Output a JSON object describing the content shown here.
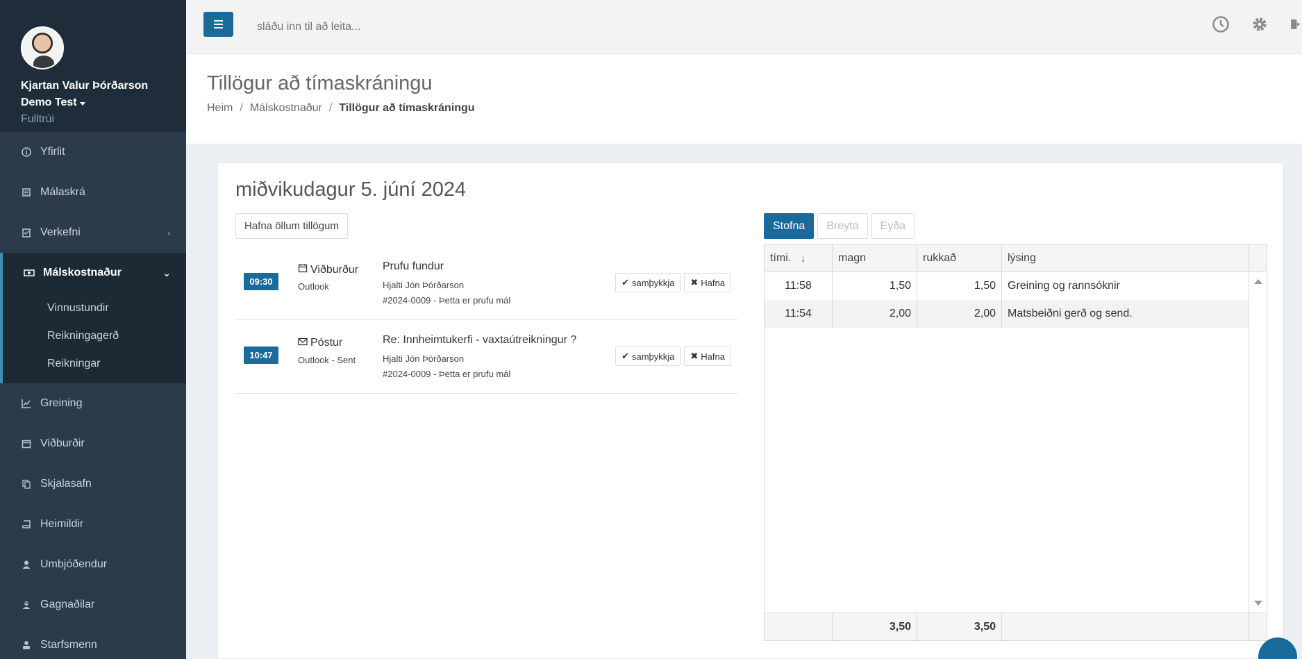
{
  "user": {
    "name": "Kjartan Valur Þórðarson",
    "company": "Demo Test",
    "role": "Fulltrúi"
  },
  "nav": {
    "items": [
      {
        "label": "Yfirlit",
        "icon": "info-circle-icon"
      },
      {
        "label": "Málaskrá",
        "icon": "archive-icon"
      },
      {
        "label": "Verkefni",
        "icon": "checklist-icon"
      },
      {
        "label": "Málskostnaður",
        "icon": "money-icon"
      },
      {
        "label": "Greining",
        "icon": "line-chart-icon"
      },
      {
        "label": "Viðburðir",
        "icon": "calendar-icon"
      },
      {
        "label": "Skjalasafn",
        "icon": "documents-icon"
      },
      {
        "label": "Heimildir",
        "icon": "book-icon"
      },
      {
        "label": "Umbjóðendur",
        "icon": "user-icon"
      },
      {
        "label": "Gagnaðilar",
        "icon": "user-secret-icon"
      },
      {
        "label": "Starfsmenn",
        "icon": "staff-icon"
      }
    ],
    "submenu": [
      "Vinnustundir",
      "Reikningagerð",
      "Reikningar"
    ]
  },
  "topbar": {
    "search_placeholder": "sláðu inn til að leita..."
  },
  "header": {
    "title": "Tillögur að tímaskráningu",
    "breadcrumb": [
      "Heim",
      "Málskostnaður",
      "Tillögur að tímaskráningu"
    ]
  },
  "main": {
    "date": "miðvikudagur 5. júní 2024",
    "reject_all": "Hafna öllum tillögum",
    "suggestions": [
      {
        "time": "09:30",
        "kind": "Viðburður",
        "kind_icon": "calendar-icon",
        "source": "Outlook",
        "title": "Prufu fundur",
        "person": "Hjalti Jón Þórðarson",
        "case": "#2024-0009 - Þetta er prufu mál",
        "approve": "samþykkja",
        "reject": "Hafna"
      },
      {
        "time": "10:47",
        "kind": "Póstur",
        "kind_icon": "envelope-icon",
        "source": "Outlook - Sent",
        "title": "Re: Innheimtukerfi - vaxtaútreikningur ?",
        "person": "Hjalti Jón Þórðarson",
        "case": "#2024-0009 - Þetta er prufu mál",
        "approve": "samþykkja",
        "reject": "Hafna"
      }
    ],
    "table_buttons": {
      "create": "Stofna",
      "edit": "Breyta",
      "delete": "Eyða"
    },
    "table": {
      "headers": [
        "tími.",
        "magn",
        "rukkað",
        "lýsing"
      ],
      "rows": [
        {
          "time": "11:58",
          "amount": "1,50",
          "charged": "1,50",
          "desc": "Greining og rannsóknir"
        },
        {
          "time": "11:54",
          "amount": "2,00",
          "charged": "2,00",
          "desc": "Matsbeiðni gerð og send."
        }
      ],
      "totals": {
        "amount": "3,50",
        "charged": "3,50"
      }
    }
  },
  "colors": {
    "primary": "#1b6a9c",
    "sidebar": "#2c3b4a",
    "accent": "#3c8dbc"
  }
}
